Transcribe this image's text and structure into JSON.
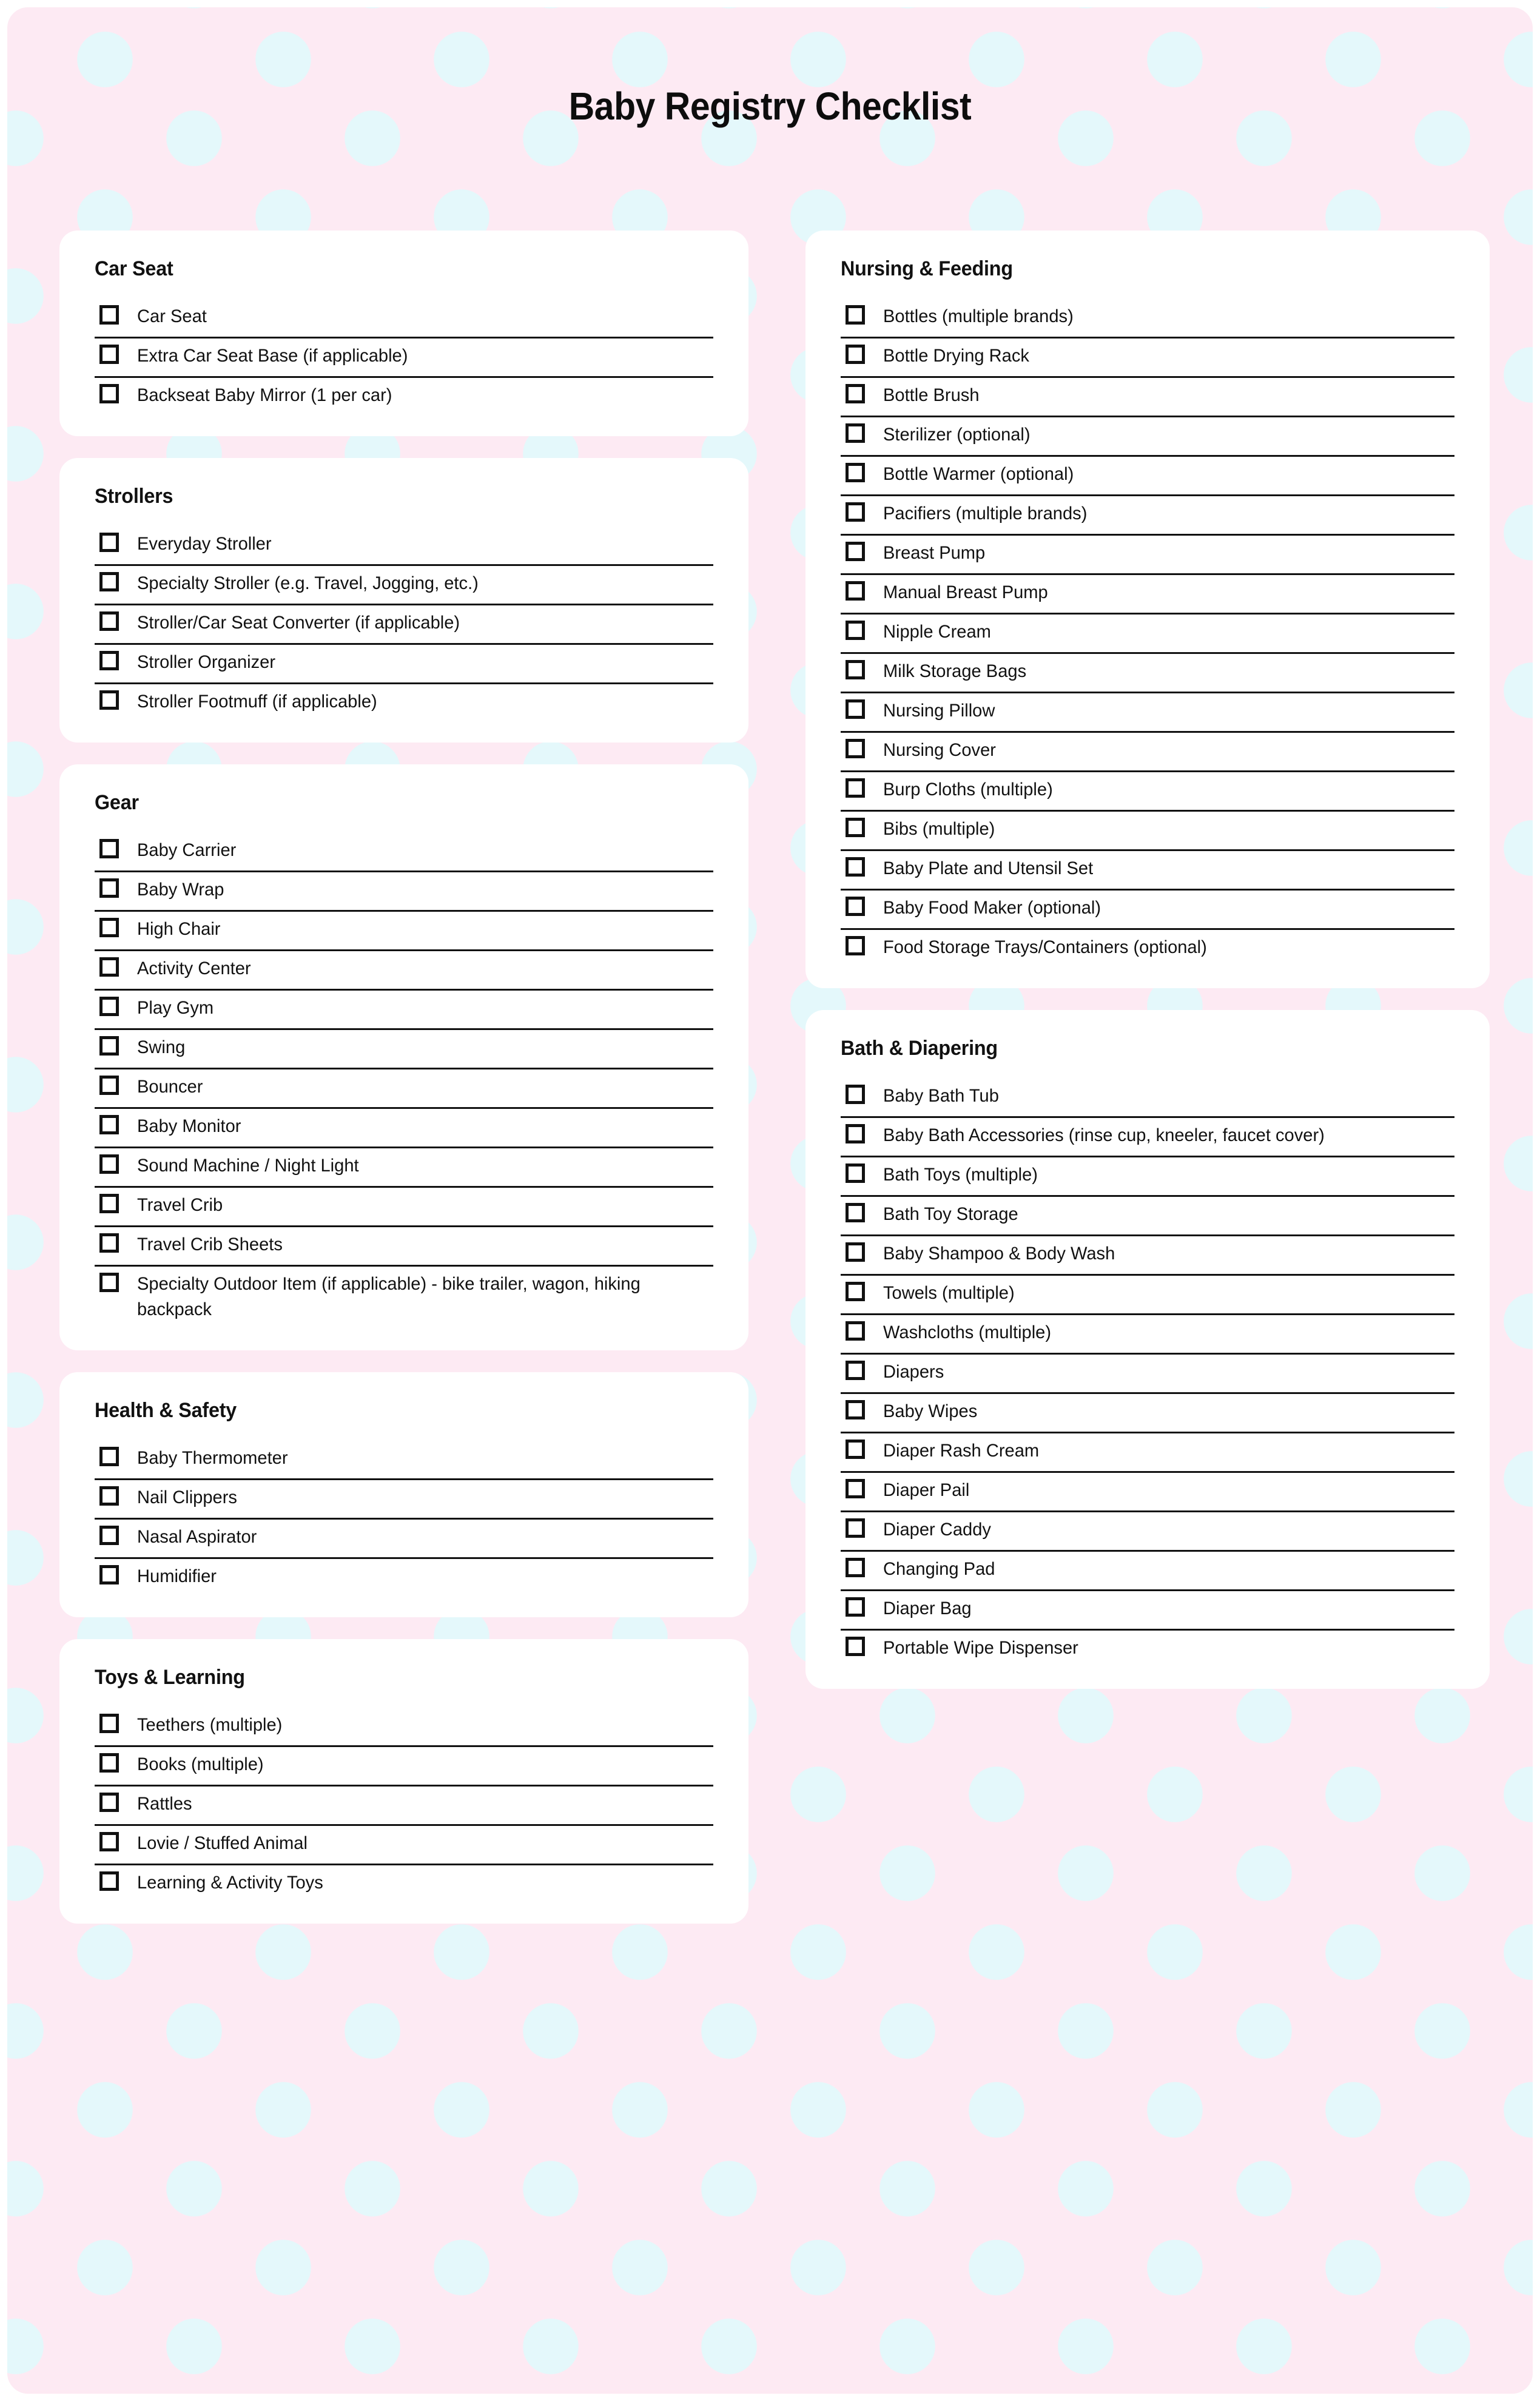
{
  "header": {
    "title": "Baby Registry Checklist"
  },
  "theme": {
    "background_pink": "#fdeaf3",
    "dot_cyan": "#e4f8fb",
    "card_white": "#ffffff",
    "ink": "#111111"
  },
  "columns": {
    "left": [
      {
        "title": "Car Seat",
        "items": [
          "Car Seat",
          "Extra Car Seat Base (if applicable)",
          "Backseat Baby Mirror (1 per car)"
        ]
      },
      {
        "title": "Strollers",
        "items": [
          "Everyday Stroller",
          "Specialty Stroller (e.g. Travel, Jogging, etc.)",
          "Stroller/Car Seat Converter (if applicable)",
          "Stroller Organizer",
          "Stroller Footmuff (if applicable)"
        ]
      },
      {
        "title": "Gear",
        "items": [
          "Baby Carrier",
          "Baby Wrap",
          "High Chair",
          "Activity Center",
          "Play Gym",
          "Swing",
          "Bouncer",
          "Baby Monitor",
          "Sound Machine / Night Light",
          "Travel Crib",
          "Travel Crib Sheets",
          "Specialty Outdoor Item (if applicable) - bike trailer, wagon, hiking backpack"
        ]
      },
      {
        "title": "Health & Safety",
        "items": [
          "Baby Thermometer",
          "Nail Clippers",
          "Nasal Aspirator",
          "Humidifier"
        ]
      },
      {
        "title": "Toys & Learning",
        "items": [
          "Teethers (multiple)",
          "Books (multiple)",
          "Rattles",
          "Lovie / Stuffed Animal",
          "Learning & Activity Toys"
        ]
      }
    ],
    "right": [
      {
        "title": "Nursing & Feeding",
        "items": [
          "Bottles (multiple brands)",
          "Bottle Drying Rack",
          "Bottle Brush",
          "Sterilizer (optional)",
          "Bottle Warmer (optional)",
          "Pacifiers (multiple brands)",
          "Breast Pump",
          "Manual Breast Pump",
          "Nipple Cream",
          "Milk Storage Bags",
          "Nursing Pillow",
          "Nursing Cover",
          "Burp Cloths (multiple)",
          "Bibs (multiple)",
          "Baby Plate and Utensil Set",
          "Baby Food Maker (optional)",
          "Food Storage Trays/Containers (optional)"
        ]
      },
      {
        "title": "Bath & Diapering",
        "items": [
          "Baby Bath Tub",
          "Baby Bath Accessories (rinse cup, kneeler, faucet cover)",
          "Bath Toys (multiple)",
          "Bath Toy Storage",
          "Baby Shampoo & Body Wash",
          "Towels (multiple)",
          "Washcloths (multiple)",
          "Diapers",
          "Baby Wipes",
          "Diaper Rash Cream",
          "Diaper Pail",
          "Diaper Caddy",
          "Changing Pad",
          "Diaper Bag",
          "Portable Wipe Dispenser"
        ]
      }
    ]
  }
}
